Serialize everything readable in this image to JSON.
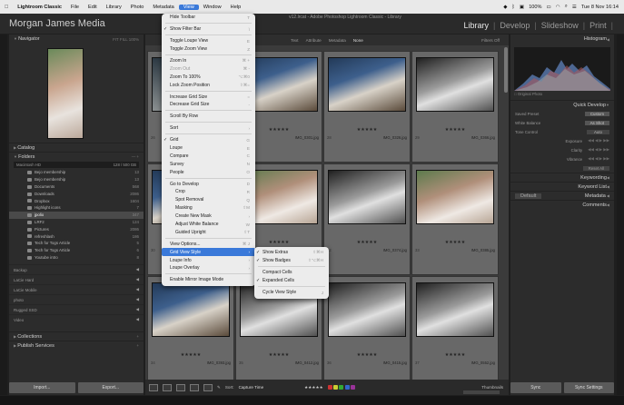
{
  "menubar": {
    "apple": "",
    "app": "Lightroom Classic",
    "items": [
      "File",
      "Edit",
      "Library",
      "Photo",
      "Metadata",
      "View",
      "Window",
      "Help"
    ],
    "selected": "View",
    "battery": "100%",
    "datetime": "Tue 8 Nov  16:14"
  },
  "window_title": "v12.lrcat - Adobe Photoshop Lightroom Classic - Library",
  "identity_plate": "Morgan James Media",
  "modules": [
    "Library",
    "Develop",
    "Slideshow",
    "Print"
  ],
  "active_module": "Library",
  "left": {
    "navigator": {
      "title": "Navigator",
      "zoom": [
        "FIT",
        "FILL",
        "100%"
      ]
    },
    "catalog": "Catalog",
    "folders": {
      "title": "Folders",
      "volume": {
        "name": "Macintosh HD",
        "size": "128 / 500 GB"
      },
      "items": [
        {
          "name": "Bejo membership",
          "count": "13"
        },
        {
          "name": "Bejo membership",
          "count": "13"
        },
        {
          "name": "Documents",
          "count": "568"
        },
        {
          "name": "Downloads",
          "count": "2086"
        },
        {
          "name": "Dropbox",
          "count": "1604"
        },
        {
          "name": "Highlight icons",
          "count": "7"
        },
        {
          "name": "jpolio",
          "count": "347"
        },
        {
          "name": "LRF2",
          "count": "124"
        },
        {
          "name": "Pictures",
          "count": "2086"
        },
        {
          "name": "refreshlash",
          "count": "186"
        },
        {
          "name": "Tech for Togs Article",
          "count": "5"
        },
        {
          "name": "Tech for Togs Article",
          "count": "6"
        },
        {
          "name": "Youtube intro",
          "count": "8"
        }
      ],
      "selected_index": 6
    },
    "volumes": [
      {
        "name": "Backup",
        "size": ""
      },
      {
        "name": "LaCie Hard",
        "size": ""
      },
      {
        "name": "LaCie Mobile",
        "size": ""
      },
      {
        "name": "photo",
        "size": ""
      },
      {
        "name": "Rugged SSD",
        "size": ""
      },
      {
        "name": "Video",
        "size": ""
      }
    ],
    "collections": "Collections",
    "publish": "Publish Services",
    "import_label": "Import...",
    "export_label": "Export..."
  },
  "filterbar": {
    "items": [
      "Text",
      "Attribute",
      "Metadata",
      "None"
    ],
    "active": "None",
    "filters_off": "Filters Off"
  },
  "grid": {
    "cells": [
      {
        "num": "26",
        "file": "",
        "stars": "",
        "tone": "dark"
      },
      {
        "num": "27",
        "file": "IMG_0301.jpg",
        "stars": "★★★★★",
        "tone": "color"
      },
      {
        "num": "28",
        "file": "IMG_0326.jpg",
        "stars": "★★★★★",
        "tone": "color"
      },
      {
        "num": "29",
        "file": "IMG_0366.jpg",
        "stars": "★★★★★",
        "tone": "bw"
      },
      {
        "num": "30",
        "file": "",
        "stars": "",
        "tone": "color"
      },
      {
        "num": "31",
        "file": "",
        "stars": "★★★★★",
        "tone": "bride"
      },
      {
        "num": "32",
        "file": "IMG_0374.jpg",
        "stars": "★★★★★",
        "tone": "bw"
      },
      {
        "num": "33",
        "file": "IMG_0385.jpg",
        "stars": "★★★★★",
        "tone": "bride"
      },
      {
        "num": "34",
        "file": "IMG_0393.jpg",
        "stars": "★★★★★",
        "tone": "color"
      },
      {
        "num": "35",
        "file": "IMG_0412.jpg",
        "stars": "★★★★★",
        "tone": "bw"
      },
      {
        "num": "36",
        "file": "IMG_0415.jpg",
        "stars": "★★★★★",
        "tone": "bw"
      },
      {
        "num": "37",
        "file": "IMG_0552.jpg",
        "stars": "★★★★★",
        "tone": "bw"
      }
    ]
  },
  "view_menu": {
    "items": [
      {
        "label": "Hide Toolbar",
        "key": "T",
        "type": "item"
      },
      {
        "type": "sep"
      },
      {
        "label": "Show Filter Bar",
        "key": "\\",
        "type": "item",
        "check": true
      },
      {
        "type": "sep"
      },
      {
        "label": "Toggle Loupe View",
        "key": "E",
        "type": "item"
      },
      {
        "label": "Toggle Zoom View",
        "key": "Z",
        "type": "item"
      },
      {
        "type": "sep"
      },
      {
        "label": "Zoom In",
        "key": "⌘ +",
        "type": "item"
      },
      {
        "label": "Zoom Out",
        "key": "⌘ -",
        "type": "item",
        "dis": true
      },
      {
        "label": "Zoom To 100%",
        "key": "⌥⌘0",
        "type": "item"
      },
      {
        "label": "Lock Zoom Position",
        "key": "⇧⌘=",
        "type": "item"
      },
      {
        "type": "sep"
      },
      {
        "label": "Increase Grid Size",
        "key": "=",
        "type": "item"
      },
      {
        "label": "Decrease Grid Size",
        "key": "-",
        "type": "item"
      },
      {
        "type": "sep"
      },
      {
        "label": "Scroll By Row",
        "key": "",
        "type": "item"
      },
      {
        "type": "sep"
      },
      {
        "label": "Sort",
        "key": "›",
        "type": "item"
      },
      {
        "type": "sep"
      },
      {
        "label": "Grid",
        "key": "G",
        "type": "item",
        "check": true
      },
      {
        "label": "Loupe",
        "key": "E",
        "type": "item"
      },
      {
        "label": "Compare",
        "key": "C",
        "type": "item"
      },
      {
        "label": "Survey",
        "key": "N",
        "type": "item"
      },
      {
        "label": "People",
        "key": "O",
        "type": "item"
      },
      {
        "type": "sep"
      },
      {
        "label": "Go to Develop",
        "key": "D",
        "type": "item"
      },
      {
        "label": "Crop",
        "key": "R",
        "type": "item",
        "indent": true
      },
      {
        "label": "Spot Removal",
        "key": "Q",
        "type": "item",
        "indent": true
      },
      {
        "label": "Masking",
        "key": "⇧M",
        "type": "item",
        "indent": true
      },
      {
        "label": "Create New Mask",
        "key": "›",
        "type": "item",
        "indent": true
      },
      {
        "label": "Adjust White Balance",
        "key": "W",
        "type": "item",
        "indent": true
      },
      {
        "label": "Guided Upright",
        "key": "⇧T",
        "type": "item",
        "indent": true
      },
      {
        "type": "sep"
      },
      {
        "label": "View Options...",
        "key": "⌘ J",
        "type": "item"
      },
      {
        "label": "Grid View Style",
        "key": "›",
        "type": "item",
        "hl": true
      },
      {
        "label": "Loupe Info",
        "key": "›",
        "type": "item"
      },
      {
        "label": "Loupe Overlay",
        "key": "›",
        "type": "item"
      },
      {
        "type": "sep"
      },
      {
        "label": "Enable Mirror Image Mode",
        "key": "",
        "type": "item"
      }
    ]
  },
  "sub_menu": {
    "items": [
      {
        "label": "Show Extras",
        "key": "⇧⌘H",
        "type": "item",
        "check": true
      },
      {
        "label": "Show Badges",
        "key": "⇧⌥⌘H",
        "type": "item",
        "check": true
      },
      {
        "type": "sep"
      },
      {
        "label": "Compact Cells",
        "key": "",
        "type": "item"
      },
      {
        "label": "Expanded Cells",
        "key": "",
        "type": "item",
        "check": true
      },
      {
        "type": "sep"
      },
      {
        "label": "Cycle View Style",
        "key": "J",
        "type": "item"
      }
    ]
  },
  "toolbar": {
    "sort_label": "Sort:",
    "sort_value": "Capture Time",
    "stars": "★★★★★",
    "thumbs_label": "Thumbnails"
  },
  "right": {
    "histogram": "Histogram",
    "original_photo": "Original Photo",
    "quick_develop": "Quick Develop",
    "saved_preset_label": "Saved Preset",
    "saved_preset_value": "Custom",
    "white_balance_label": "White Balance",
    "white_balance_value": "As Shot",
    "tone_control_label": "Tone Control",
    "auto_label": "Auto",
    "exposure_label": "Exposure",
    "clarity_label": "Clarity",
    "vibrance_label": "Vibrance",
    "reset_all": "Reset All",
    "keywording": "Keywording",
    "keyword_list": "Keyword List",
    "metadata": "Metadata",
    "metadata_value": "Default",
    "comments": "Comments",
    "sync_label": "Sync",
    "sync_settings_label": "Sync Settings"
  },
  "colors": {
    "accent": "#3a79d9",
    "panel": "#2c2c2c",
    "grid_bg": "#3b3b3b",
    "cell": "#686868"
  }
}
